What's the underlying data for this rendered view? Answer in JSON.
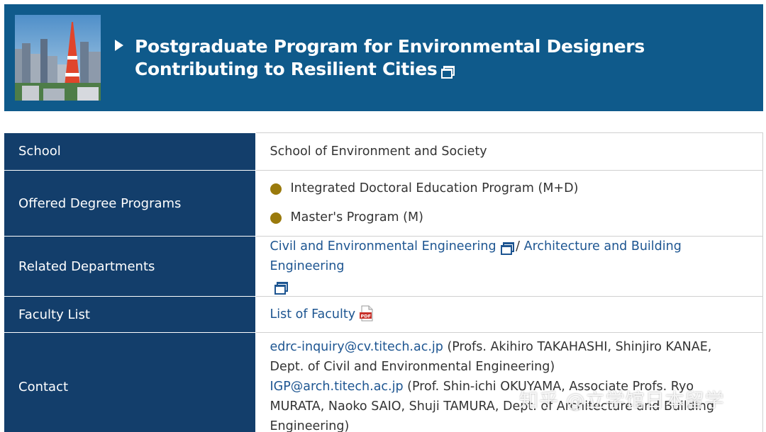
{
  "banner": {
    "title": "Postgraduate Program for Environmental Designers Contributing to Resilient Cities",
    "image": "tokyo-tower-city-photo"
  },
  "table": {
    "school": {
      "label": "School",
      "value": "School of Environment and Society"
    },
    "degree_programs": {
      "label": "Offered Degree Programs",
      "items": [
        "Integrated Doctoral Education Program (M+D)",
        "Master's Program (M)"
      ]
    },
    "related_departments": {
      "label": "Related Departments",
      "links": [
        "Civil and Environmental Engineering",
        "Architecture and Building Engineering"
      ],
      "separator": " / "
    },
    "faculty_list": {
      "label": "Faculty List",
      "link": "List of Faculty"
    },
    "contact": {
      "label": "Contact",
      "entries": [
        {
          "email": "edrc-inquiry@cv.titech.ac.jp",
          "text": " (Profs. Akihiro TAKAHASHI, Shinjiro KANAE, Dept. of Civil and Environmental Engineering)"
        },
        {
          "email": "IGP@arch.titech.ac.jp",
          "text": " (Prof. Shin-ichi OKUYAMA, Associate Profs. Ryo MURATA, Naoko SAIO, Shuji TAMURA, Dept. of Architecture and Building Engineering)"
        }
      ]
    }
  },
  "watermark": "知乎 @立学馆日本留学",
  "colors": {
    "banner_bg": "#0f5a8b",
    "header_cell_bg": "#133e6b",
    "link": "#1d5591",
    "bullet": "#9a7a0c"
  },
  "icons": {
    "external_link": "external-window-icon",
    "pdf": "pdf-icon",
    "play": "play-triangle-icon"
  }
}
